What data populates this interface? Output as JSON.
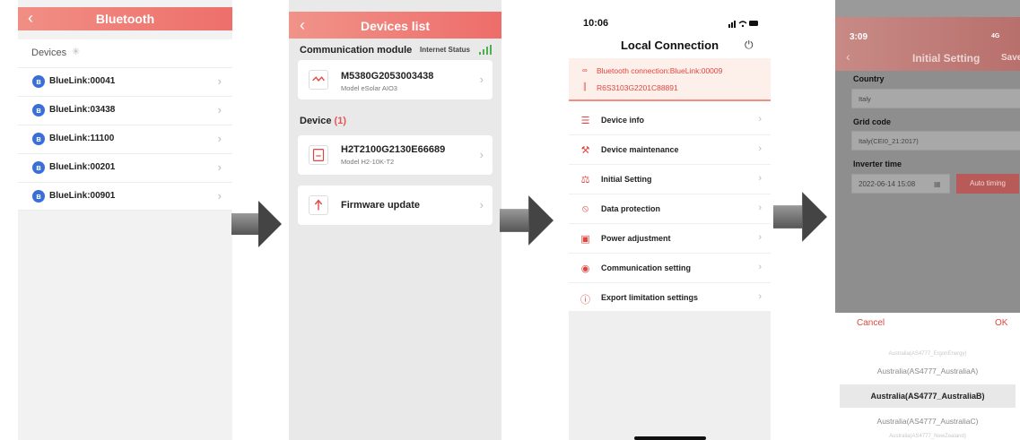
{
  "screen1": {
    "title": "Bluetooth",
    "devices_label": "Devices",
    "items": [
      {
        "label": "BlueLink:00041"
      },
      {
        "label": "BlueLink:03438"
      },
      {
        "label": "BlueLink:11100"
      },
      {
        "label": "BlueLink:00201"
      },
      {
        "label": "BlueLink:00901"
      }
    ]
  },
  "screen2": {
    "title": "Devices list",
    "section_comm": "Communication module",
    "internet_status": "Internet Status",
    "comm_card": {
      "serial": "M5380G2053003438",
      "model": "Model  eSolar AIO3"
    },
    "section_device": "Device",
    "device_count": "(1)",
    "device_card": {
      "serial": "H2T2100G2130E66689",
      "model": "Model  H2-10K-T2"
    },
    "firmware": "Firmware update"
  },
  "screen3": {
    "time": "10:06",
    "status_icons": "∥‥ ▬",
    "title": "Local Connection",
    "bt_connection": "Bluetooth connection:BlueLink:00009",
    "serial": "R6S3103G2201C88891",
    "menu": [
      {
        "label": "Device info",
        "icon": "device-info-icon"
      },
      {
        "label": "Device maintenance",
        "icon": "wrench-icon"
      },
      {
        "label": "Initial Setting",
        "icon": "settings-icon"
      },
      {
        "label": "Data protection",
        "icon": "protection-icon"
      },
      {
        "label": "Power adjustment",
        "icon": "power-adjust-icon"
      },
      {
        "label": "Communication setting",
        "icon": "antenna-icon"
      },
      {
        "label": "Export limitation settings",
        "icon": "limit-icon"
      }
    ]
  },
  "screen4": {
    "time": "3:09",
    "status": "4G",
    "title": "Initial Setting",
    "save": "Save",
    "country_label": "Country",
    "country_value": "Italy",
    "grid_label": "Grid code",
    "grid_value": "Italy(CEI0_21:2017)",
    "inverter_time_label": "Inverter time",
    "inverter_time_value": "2022-06-14 15:08",
    "auto_timing": "Auto timing",
    "cancel": "Cancel",
    "ok": "OK",
    "options": {
      "above2": "Australia(AS4777_ErgonEnergy)",
      "above1": "Australia(AS4777_AustraliaA)",
      "selected": "Australia(AS4777_AustraliaB)",
      "below1": "Australia(AS4777_AustraliaC)",
      "below2": "Australia(AS4777_NewZealand)"
    }
  },
  "colors": {
    "accent": "#ee6f6b",
    "accent_light": "#f08f85",
    "text_red": "#e0453f",
    "bluetooth": "#3a6fd8"
  }
}
